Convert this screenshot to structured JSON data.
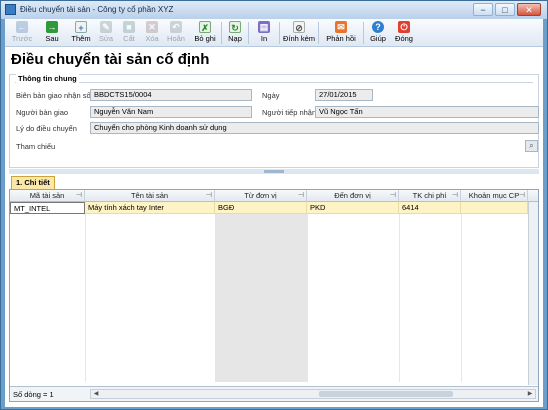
{
  "window": {
    "title": "Điều chuyển tài sản - Công ty cổ phần XYZ",
    "minimize": "−",
    "maximize": "□",
    "close": "✕"
  },
  "toolbar": {
    "items": [
      {
        "label": "Trước",
        "icon": "arrow-left-icon",
        "enabled": false
      },
      {
        "label": "Sau",
        "icon": "arrow-right-icon",
        "enabled": true
      },
      {
        "label": "Thêm",
        "icon": "add-icon",
        "enabled": true
      },
      {
        "label": "Sửa",
        "icon": "edit-icon",
        "enabled": false
      },
      {
        "label": "Cất",
        "icon": "save-icon",
        "enabled": false
      },
      {
        "label": "Xóa",
        "icon": "delete-icon",
        "enabled": false
      },
      {
        "label": "Hoãn",
        "icon": "undo-icon",
        "enabled": false
      },
      {
        "label": "Bỏ ghi",
        "icon": "unpost-icon",
        "enabled": true
      },
      {
        "label": "Nạp",
        "icon": "refresh-icon",
        "enabled": true
      },
      {
        "label": "In",
        "icon": "print-icon",
        "enabled": true
      },
      {
        "label": "Đính kèm",
        "icon": "attach-icon",
        "enabled": true
      },
      {
        "label": "Phản hồi",
        "icon": "feedback-icon",
        "enabled": true
      },
      {
        "label": "Giúp",
        "icon": "help-icon",
        "enabled": true
      },
      {
        "label": "Đóng",
        "icon": "close-icon",
        "enabled": true
      }
    ]
  },
  "page": {
    "title": "Điều chuyển tài sản cố định"
  },
  "general": {
    "section_title": "Thông tin chung",
    "transfer_no_label": "Biên bản giao nhận số",
    "transfer_no": "BBDCTS15/0004",
    "date_label": "Ngày",
    "date": "27/01/2015",
    "sender_label": "Người bàn giao",
    "sender": "Nguyễn Văn Nam",
    "receiver_label": "Người tiếp nhận",
    "receiver": "Vũ Ngọc Tấn",
    "reason_label": "Lý do điều chuyển",
    "reason": "Chuyển cho phòng Kinh doanh sử dụng",
    "reference_label": "Tham chiếu"
  },
  "details": {
    "tab_label": "1. Chi tiết",
    "columns": [
      "Mã tài sản",
      "Tên tài sản",
      "Từ đơn vị",
      "Đến đơn vị",
      "TK chi phí",
      "Khoản mục CP"
    ],
    "rows": [
      [
        "MT_INTEL",
        "Máy tính xách tay Inter",
        "BGĐ",
        "PKD",
        "6414",
        ""
      ]
    ],
    "row_count": "Số dòng = 1"
  },
  "colors": {
    "titlebar": "#c9dcef",
    "selected_row": "#fdf3c4",
    "tab": "#fbe8a8"
  }
}
